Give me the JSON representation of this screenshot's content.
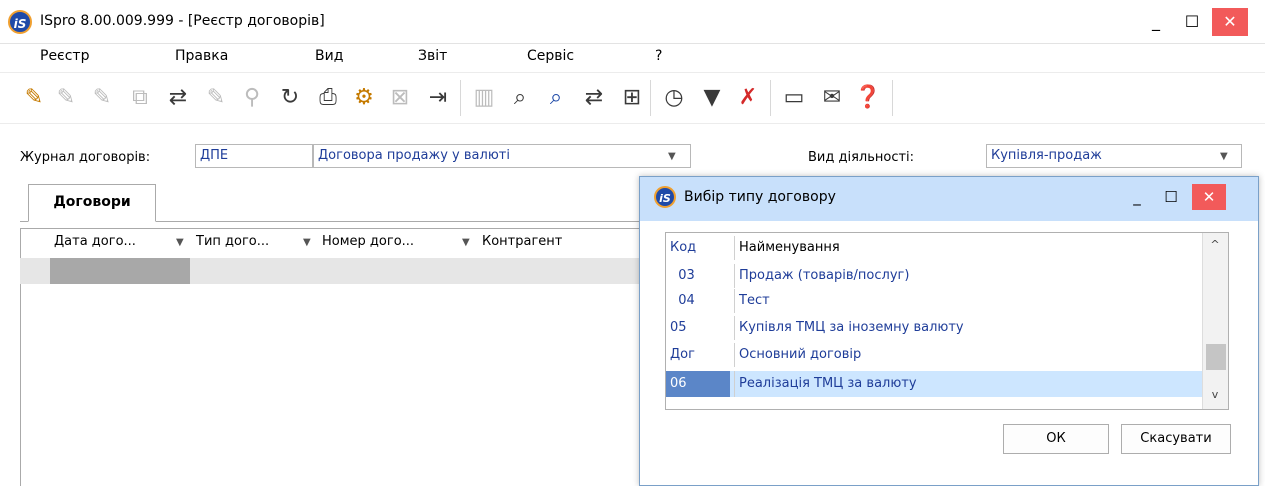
{
  "window": {
    "title": "ISpro 8.00.009.999 - [Реєстр договорів]",
    "logo_text": "iS",
    "controls": {
      "minimize": "_",
      "maximize": "☐",
      "close": "✕"
    }
  },
  "menu": [
    "Реєстр",
    "Правка",
    "Вид",
    "Звіт",
    "Сервіс",
    "?"
  ],
  "toolbar": {
    "icons": [
      "new-doc-star-icon",
      "edit-doc-icon",
      "delete-doc-icon",
      "copy-doc-icon",
      "transfer-icon",
      "tag-icon",
      "filter-funnel-icon",
      "refresh-icon",
      "print-icon",
      "gear-box-icon",
      "excel-icon",
      "export-icon",
      "book-icon",
      "find-icon",
      "find-next-icon",
      "import-icon",
      "tree-icon",
      "date-doc-icon",
      "filter-icon",
      "clear-filter-icon",
      "form-icon",
      "mail-icon",
      "help-icon"
    ],
    "glyphs": [
      "✎",
      "✎",
      "✎",
      "⧉",
      "⇄",
      "✎",
      "⚲",
      "↻",
      "⎙",
      "⚙",
      "⊠",
      "⇥",
      "▥",
      "⌕",
      "⌕",
      "⇄",
      "⊞",
      "◷",
      "▼",
      "✗",
      "▭",
      "✉",
      "❓"
    ]
  },
  "filters": {
    "journal_label": "Журнал договорів:",
    "journal_code": "ДПЕ",
    "journal_name": "Договора продажу у валюті",
    "activity_label": "Вид діяльності:",
    "activity_value": "Купівля-продаж",
    "arrow": "▼"
  },
  "tabs": {
    "contracts": "Договори"
  },
  "grid": {
    "columns": [
      "Дата дого...",
      "Тип дого...",
      "Номер дого...",
      "Контрагент"
    ],
    "filter_glyph": "▼"
  },
  "dialog": {
    "title": "Вибір типу договору",
    "logo_text": "iS",
    "controls": {
      "minimize": "_",
      "maximize": "☐",
      "close": "✕"
    },
    "headers": {
      "code": "Код",
      "name": "Найменування"
    },
    "rows": [
      {
        "code": "  03",
        "name": "Продаж (товарів/послуг)"
      },
      {
        "code": "  04",
        "name": "Тест"
      },
      {
        "code": "05",
        "name": "Купівля ТМЦ за іноземну валюту"
      },
      {
        "code": "Дог",
        "name": "Основний договір"
      },
      {
        "code": "06",
        "name": "Реалізація ТМЦ за валюту"
      }
    ],
    "selected_index": 4,
    "scroll": {
      "up": "^",
      "down": "v"
    },
    "buttons": {
      "ok": "ОК",
      "cancel": "Скасувати"
    }
  }
}
